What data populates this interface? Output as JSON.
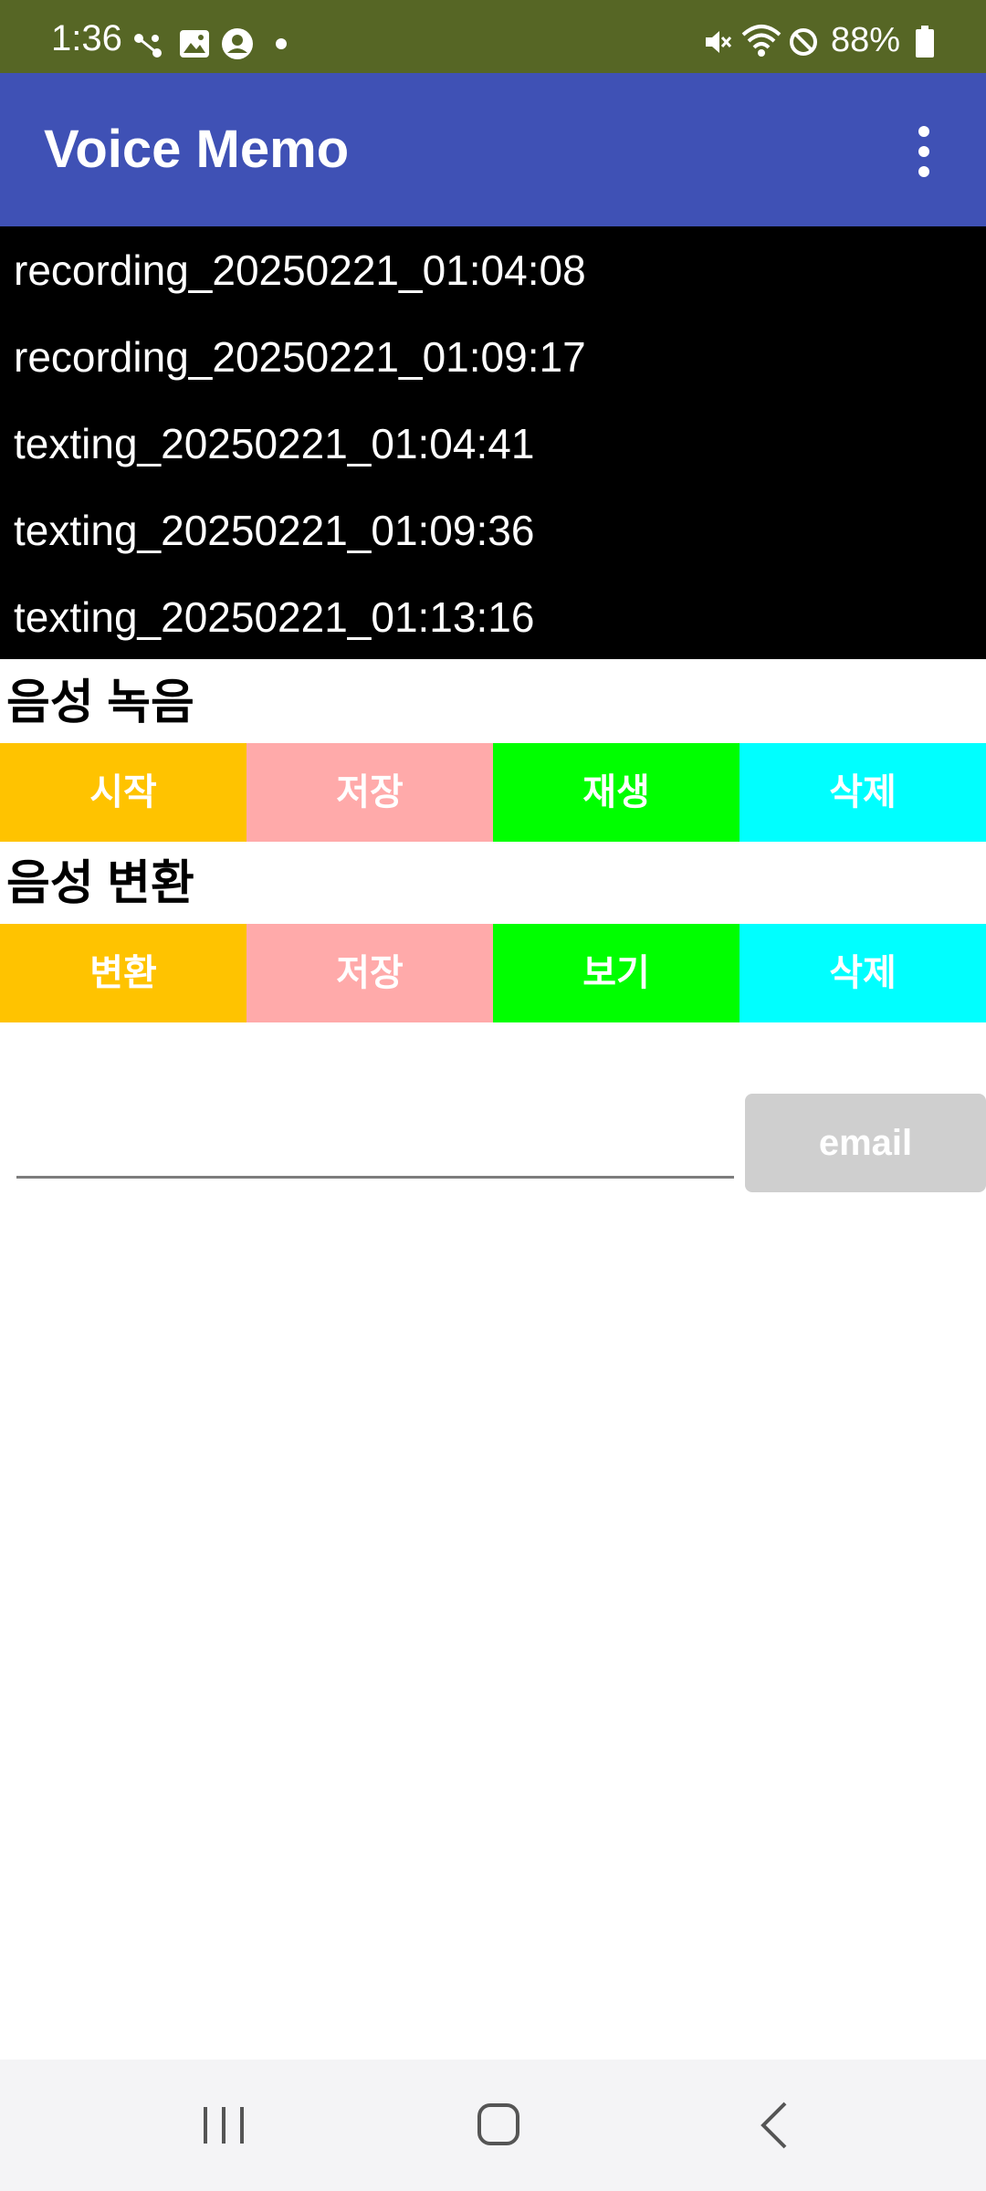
{
  "status_bar": {
    "time": "1:36",
    "left_icons": [
      "connect-icon",
      "gallery-icon",
      "account-icon",
      "dot-icon"
    ],
    "right_icons": [
      "mute-icon",
      "wifi-icon",
      "blocked-icon",
      "battery-icon"
    ],
    "battery": "88%",
    "background_color": "#566625"
  },
  "app_bar": {
    "title": "Voice Memo",
    "menu_icon": "more-vert-icon",
    "background_color": "#3f51b5"
  },
  "file_list": {
    "items": [
      "recording_20250221_01:04:08",
      "recording_20250221_01:09:17",
      "texting_20250221_01:04:41",
      "texting_20250221_01:09:36",
      "texting_20250221_01:13:16"
    ]
  },
  "voice_recording": {
    "title": "음성 녹음",
    "buttons": [
      {
        "label": "시작",
        "color": "#ffc300"
      },
      {
        "label": "저장",
        "color": "#ffaaaa"
      },
      {
        "label": "재생",
        "color": "#00ff00"
      },
      {
        "label": "삭제",
        "color": "#00ffff"
      }
    ]
  },
  "voice_conversion": {
    "title": "음성 변환",
    "buttons": [
      {
        "label": "변환",
        "color": "#ffc300"
      },
      {
        "label": "저장",
        "color": "#ffaaaa"
      },
      {
        "label": "보기",
        "color": "#00ff00"
      },
      {
        "label": "삭제",
        "color": "#00ffff"
      }
    ]
  },
  "email": {
    "input_value": "",
    "button_label": "email"
  },
  "nav_bar": {
    "icons": [
      "recent-apps-icon",
      "home-icon",
      "back-icon"
    ]
  }
}
